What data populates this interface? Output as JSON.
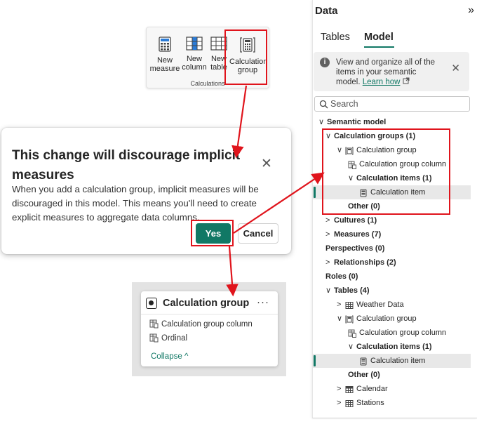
{
  "ribbon": {
    "buttons": [
      {
        "label_line1": "New",
        "label_line2": "measure",
        "icon": "calculator-icon"
      },
      {
        "label_line1": "New",
        "label_line2": "column",
        "icon": "table-column-icon"
      },
      {
        "label_line1": "New",
        "label_line2": "table",
        "icon": "table-icon"
      },
      {
        "label_line1": "Calculation",
        "label_line2": "group",
        "icon": "calculation-group-icon"
      }
    ],
    "group_label": "Calculations"
  },
  "dialog": {
    "title": "This change will discourage implicit measures",
    "body": "When you add a calculation group, implicit measures will be discouraged in this model. This means you'll need to create explicit measures to aggregate data columns.",
    "yes_label": "Yes",
    "cancel_label": "Cancel"
  },
  "card": {
    "title": "Calculation group",
    "menu": "···",
    "rows": [
      "Calculation group column",
      "Ordinal"
    ],
    "collapse_label": "Collapse ^"
  },
  "pane": {
    "title": "Data",
    "collapse_glyph": "»",
    "tabs": [
      "Tables",
      "Model"
    ],
    "active_tab": "Model",
    "info_text": "View and organize all of the items in your semantic model.",
    "info_link": "Learn how",
    "search_placeholder": "Search",
    "tree": [
      {
        "label": "Semantic model",
        "chev": "down",
        "level": 0,
        "bold": true
      },
      {
        "label": "Calculation groups (1)",
        "chev": "down",
        "level": 1,
        "bold": true
      },
      {
        "label": "Calculation group",
        "chev": "down",
        "level": 2,
        "icon": "calc-group-icon"
      },
      {
        "label": "Calculation group column",
        "level": 3,
        "icon": "column-icon"
      },
      {
        "label": "Calculation items (1)",
        "chev": "down",
        "level": 3,
        "bold": true
      },
      {
        "label": "Calculation item",
        "level": 4,
        "icon": "calc-item-icon",
        "selected": true
      },
      {
        "label": "Other (0)",
        "level": 3,
        "bold": true
      },
      {
        "label": "Cultures (1)",
        "chev": "right",
        "level": 1,
        "bold": true
      },
      {
        "label": "Measures (7)",
        "chev": "right",
        "level": 1,
        "bold": true
      },
      {
        "label": "Perspectives (0)",
        "level": 1,
        "bold": true
      },
      {
        "label": "Relationships (2)",
        "chev": "right",
        "level": 1,
        "bold": true
      },
      {
        "label": "Roles (0)",
        "level": 1,
        "bold": true
      },
      {
        "label": "Tables (4)",
        "chev": "down",
        "level": 1,
        "bold": true
      },
      {
        "label": "Weather Data",
        "chev": "right",
        "level": 2,
        "icon": "table-icon"
      },
      {
        "label": "Calculation group",
        "chev": "down",
        "level": 2,
        "icon": "calc-group-icon"
      },
      {
        "label": "Calculation group column",
        "level": 3,
        "icon": "column-icon"
      },
      {
        "label": "Calculation items (1)",
        "chev": "down",
        "level": 3,
        "bold": true
      },
      {
        "label": "Calculation item",
        "level": 4,
        "icon": "calc-item-icon",
        "selected": true
      },
      {
        "label": "Other (0)",
        "level": 3,
        "bold": true
      },
      {
        "label": "Calendar",
        "chev": "right",
        "level": 2,
        "icon": "calendar-table-icon"
      },
      {
        "label": "Stations",
        "chev": "right",
        "level": 2,
        "icon": "table-icon"
      }
    ]
  },
  "colors": {
    "accent": "#117865",
    "highlight": "#e0141c",
    "selected_row": "#e8e8e8"
  }
}
